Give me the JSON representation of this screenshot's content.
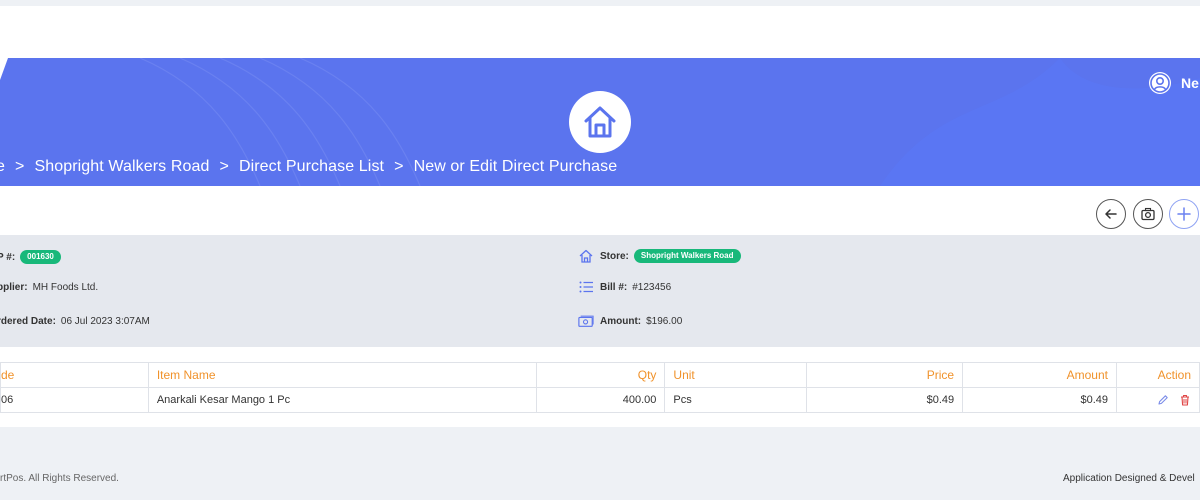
{
  "header": {
    "user_name": "Ne",
    "breadcrumb": [
      "e",
      "Shopright Walkers Road",
      "Direct Purchase List",
      "New or Edit Direct Purchase"
    ],
    "separator": ">",
    "icons": [
      "home-icon",
      "user-icon"
    ],
    "colors": {
      "hero": "#5b74ee",
      "white": "#ffffff"
    }
  },
  "toolbar": {
    "icons": [
      "back-arrow-icon",
      "camera-icon",
      "plus-icon"
    ]
  },
  "info": {
    "dp_label": "P #:",
    "dp_value": "001630",
    "supplier_label": "pplier:",
    "supplier_value": "MH Foods Ltd.",
    "ordered_label": "rdered Date:",
    "ordered_value": "06 Jul 2023 3:07AM",
    "store_label": "Store:",
    "store_value": "Shopright Walkers Road",
    "bill_label": "Bill #:",
    "bill_value": "#123456",
    "amount_label": "Amount:",
    "amount_value": "$196.00",
    "badge_color": "#18b87a"
  },
  "table": {
    "headers": {
      "code": "de",
      "item_name": "Item Name",
      "qty": "Qty",
      "unit": "Unit",
      "price": "Price",
      "amount": "Amount",
      "action": "Action"
    },
    "rows": [
      {
        "code": "06",
        "item_name": "Anarkali Kesar Mango 1 Pc",
        "qty": "400.00",
        "unit": "Pcs",
        "price": "$0.49",
        "amount": "$0.49"
      }
    ],
    "header_color": "#f0922b"
  },
  "footer": {
    "left": "rtPos. All Rights Reserved.",
    "right": "Application Designed & Devel"
  }
}
